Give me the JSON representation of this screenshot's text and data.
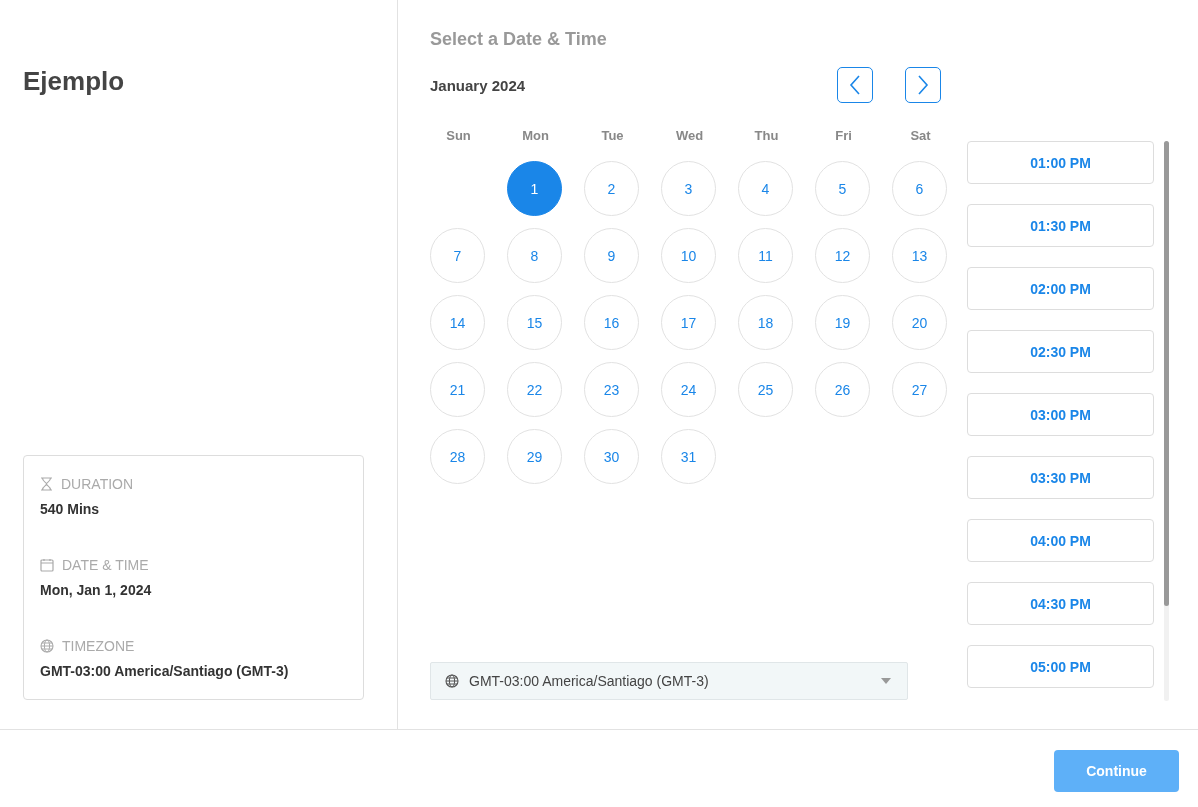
{
  "event": {
    "title": "Ejemplo"
  },
  "details": [
    {
      "kind": "duration",
      "label": "DURATION",
      "value": "540 Mins"
    },
    {
      "kind": "date",
      "label": "DATE & TIME",
      "value": "Mon, Jan 1, 2024"
    },
    {
      "kind": "timezone",
      "label": "TIMEZONE",
      "value": "GMT-03:00 America/Santiago (GMT-3)"
    }
  ],
  "heading": "Select a Date & Time",
  "month": "January 2024",
  "weekdays": [
    "Sun",
    "Mon",
    "Tue",
    "Wed",
    "Thu",
    "Fri",
    "Sat"
  ],
  "weeks": [
    [
      {
        "kind": "blank"
      },
      {
        "kind": "day",
        "label": "1",
        "selected": true
      },
      {
        "kind": "day",
        "label": "2",
        "selected": false
      },
      {
        "kind": "day",
        "label": "3",
        "selected": false
      },
      {
        "kind": "day",
        "label": "4",
        "selected": false
      },
      {
        "kind": "day",
        "label": "5",
        "selected": false
      },
      {
        "kind": "day",
        "label": "6",
        "selected": false
      }
    ],
    [
      {
        "kind": "day",
        "label": "7",
        "selected": false
      },
      {
        "kind": "day",
        "label": "8",
        "selected": false
      },
      {
        "kind": "day",
        "label": "9",
        "selected": false
      },
      {
        "kind": "day",
        "label": "10",
        "selected": false
      },
      {
        "kind": "day",
        "label": "11",
        "selected": false
      },
      {
        "kind": "day",
        "label": "12",
        "selected": false
      },
      {
        "kind": "day",
        "label": "13",
        "selected": false
      }
    ],
    [
      {
        "kind": "day",
        "label": "14",
        "selected": false
      },
      {
        "kind": "day",
        "label": "15",
        "selected": false
      },
      {
        "kind": "day",
        "label": "16",
        "selected": false
      },
      {
        "kind": "day",
        "label": "17",
        "selected": false
      },
      {
        "kind": "day",
        "label": "18",
        "selected": false
      },
      {
        "kind": "day",
        "label": "19",
        "selected": false
      },
      {
        "kind": "day",
        "label": "20",
        "selected": false
      }
    ],
    [
      {
        "kind": "day",
        "label": "21",
        "selected": false
      },
      {
        "kind": "day",
        "label": "22",
        "selected": false
      },
      {
        "kind": "day",
        "label": "23",
        "selected": false
      },
      {
        "kind": "day",
        "label": "24",
        "selected": false
      },
      {
        "kind": "day",
        "label": "25",
        "selected": false
      },
      {
        "kind": "day",
        "label": "26",
        "selected": false
      },
      {
        "kind": "day",
        "label": "27",
        "selected": false
      }
    ],
    [
      {
        "kind": "day",
        "label": "28",
        "selected": false
      },
      {
        "kind": "day",
        "label": "29",
        "selected": false
      },
      {
        "kind": "day",
        "label": "30",
        "selected": false
      },
      {
        "kind": "day",
        "label": "31",
        "selected": false
      }
    ]
  ],
  "timezone_select": {
    "value": "GMT-03:00 America/Santiago (GMT-3)"
  },
  "times": [
    {
      "label": "01:00 PM",
      "selected": false
    },
    {
      "label": "01:30 PM",
      "selected": false
    },
    {
      "label": "02:00 PM",
      "selected": false
    },
    {
      "label": "02:30 PM",
      "selected": false
    },
    {
      "label": "03:00 PM",
      "selected": false
    },
    {
      "label": "03:30 PM",
      "selected": false
    },
    {
      "label": "04:00 PM",
      "selected": false
    },
    {
      "label": "04:30 PM",
      "selected": false
    },
    {
      "label": "05:00 PM",
      "selected": false
    }
  ],
  "continue_button": {
    "label": "Continue",
    "disabled": true
  }
}
